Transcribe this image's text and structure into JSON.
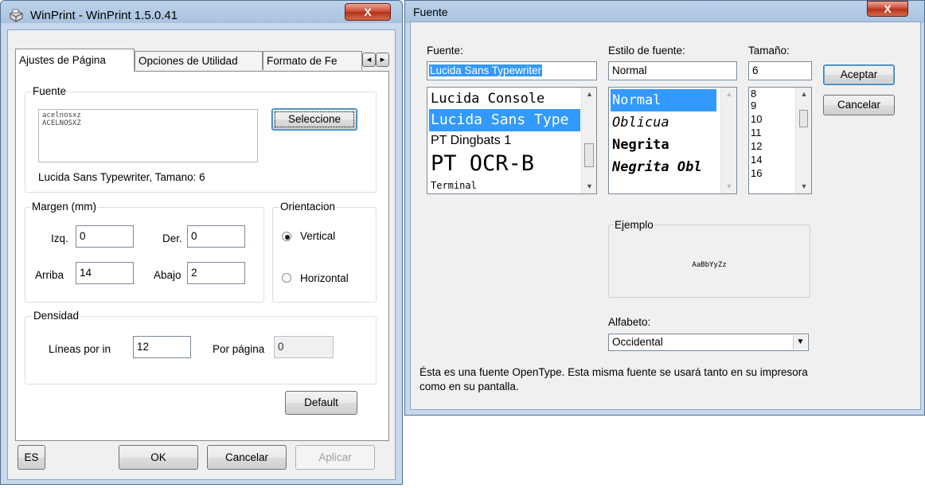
{
  "winprint": {
    "title": "WinPrint - WinPrint 1.5.0.41",
    "close": "X",
    "tabs": [
      "Ajustes de Página",
      "Opciones de Utilidad",
      "Formato de Fe"
    ],
    "tab_scroll": [
      "◂",
      "▸"
    ],
    "fuente_group": "Fuente",
    "preview_lines": [
      "acelnosxz",
      "ACELNOSXZ"
    ],
    "seleccione": "Seleccione",
    "font_desc": "Lucida Sans Typewriter, Tamano: 6",
    "margen_group": "Margen (mm)",
    "izq_label": "Izq.",
    "izq_value": "0",
    "der_label": "Der.",
    "der_value": "0",
    "arriba_label": "Arriba",
    "arriba_value": "14",
    "abajo_label": "Abajo",
    "abajo_value": "2",
    "orientacion_group": "Orientacion",
    "vertical": "Vertical",
    "horizontal": "Horizontal",
    "densidad_group": "Densidad",
    "lineas_label": "Líneas por in",
    "lineas_value": "12",
    "por_pagina_label": "Por página",
    "por_pagina_value": "0",
    "default": "Default",
    "es": "ES",
    "ok": "OK",
    "cancelar": "Cancelar",
    "aplicar": "Aplicar"
  },
  "fuente_dialog": {
    "title": "Fuente",
    "close": "X",
    "font_label": "Fuente:",
    "font_value": "Lucida Sans Typewriter",
    "fonts": [
      "Lucida Console",
      "Lucida Sans Type",
      "PT Dingbats 1",
      "PT OCR-B",
      "Terminal"
    ],
    "style_label": "Estilo de fuente:",
    "style_value": "Normal",
    "styles": [
      "Normal",
      "Oblicua",
      "Negrita",
      "Negrita Obl"
    ],
    "size_label": "Tamaño:",
    "size_value": "6",
    "sizes": [
      "8",
      "9",
      "10",
      "11",
      "12",
      "14",
      "16"
    ],
    "aceptar": "Aceptar",
    "cancelar": "Cancelar",
    "ejemplo_label": "Ejemplo",
    "ejemplo_text": "AaBbYyZz",
    "alfabeto_label": "Alfabeto:",
    "alfabeto_value": "Occidental",
    "info_text": "Ésta es una fuente OpenType. Esta misma fuente se usará tanto en su impresora como en su pantalla."
  },
  "icons": {
    "scroll_up": "▲",
    "scroll_down": "▼",
    "dropdown": "▼"
  },
  "colors": {
    "selection": "#3399ff",
    "window_frame": "#bcd2ea",
    "close_button": "#c9462f"
  }
}
